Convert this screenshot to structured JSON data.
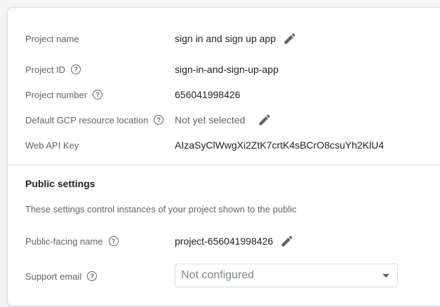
{
  "project": {
    "name_label": "Project name",
    "name_value": "sign in and sign up app",
    "id_label": "Project ID",
    "id_value": "sign-in-and-sign-up-app",
    "number_label": "Project number",
    "number_value": "656041998426",
    "location_label": "Default GCP resource location",
    "location_value": "Not yet selected",
    "api_key_label": "Web API Key",
    "api_key_value": "AIzaSyClWwgXi2ZtK7crtK4sBCrO8csuYh2KlU4"
  },
  "public_settings": {
    "title": "Public settings",
    "description": "These settings control instances of your project shown to the public",
    "facing_name_label": "Public-facing name",
    "facing_name_value": "project-656041998426",
    "support_email_label": "Support email",
    "support_email_placeholder": "Not configured"
  },
  "icons": {
    "edit": "pencil-icon",
    "help": "help-circle-icon",
    "dropdown": "caret-down-icon"
  },
  "colors": {
    "label": "#5f6368",
    "value": "#202124",
    "divider": "#dadce0"
  }
}
